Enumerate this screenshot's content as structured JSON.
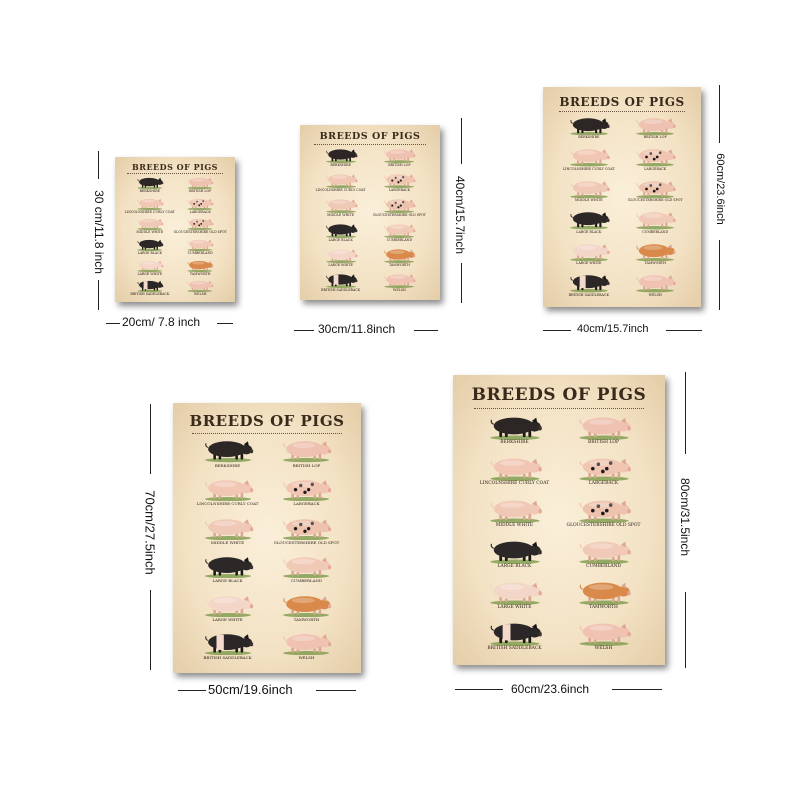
{
  "poster": {
    "title": "BREEDS OF PIGS",
    "breeds": [
      {
        "name": "BERKSHIRE",
        "color": "#2c2624"
      },
      {
        "name": "BRITISH LOP",
        "color": "#efc1b0"
      },
      {
        "name": "LINCOLNSHIRE CURLY COAT",
        "color": "#f1c7b4"
      },
      {
        "name": "LARGEBACK",
        "color": "#f0c5b1",
        "spots": true
      },
      {
        "name": "MIDDLE WHITE",
        "color": "#f0c8b6"
      },
      {
        "name": "GLOUCESTERSHIRE OLD SPOT",
        "color": "#eec3ae",
        "spots": true
      },
      {
        "name": "LARGE BLACK",
        "color": "#2d2828"
      },
      {
        "name": "CUMBERLAND",
        "color": "#f1cab7"
      },
      {
        "name": "LARGE WHITE",
        "color": "#f3d6c8"
      },
      {
        "name": "TAMWORTH",
        "color": "#d98a4a"
      },
      {
        "name": "BRITISH SADDLEBACK",
        "color": "#2b2727",
        "band": true
      },
      {
        "name": "WELSH",
        "color": "#f0c2b2"
      }
    ]
  },
  "sizes": [
    {
      "width": "20cm/ 7.8 inch",
      "height": "30 cm/11.8 inch"
    },
    {
      "width": "30cm/11.8inch",
      "height": "40cm/15.7inch"
    },
    {
      "width": "40cm/15.7inch",
      "height": "60cm/23.6inch"
    },
    {
      "width": "50cm/19.6inch",
      "height": "70cm/27.5inch"
    },
    {
      "width": "60cm/23.6inch",
      "height": "80cm/31.5inch"
    }
  ]
}
